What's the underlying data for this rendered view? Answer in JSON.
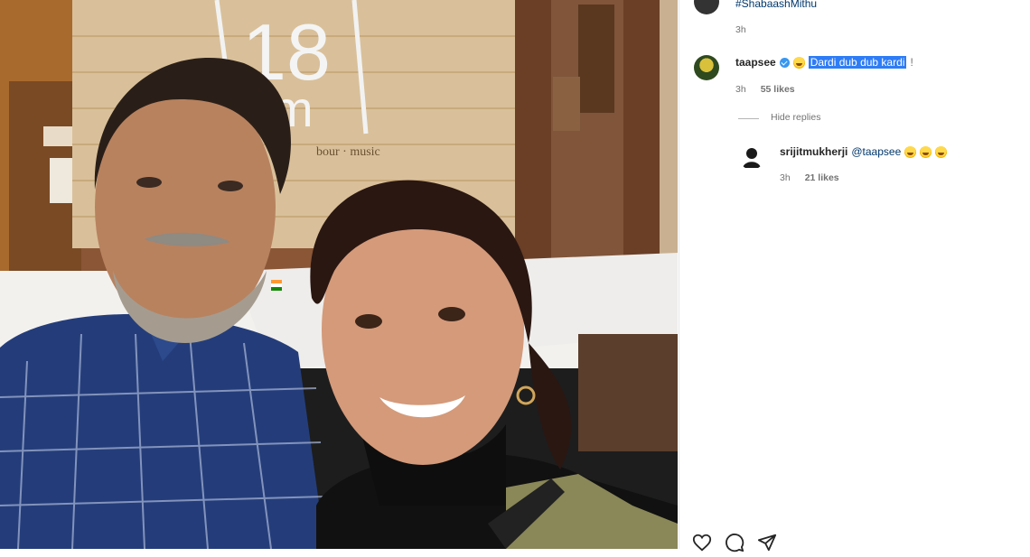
{
  "post_photo": {
    "wall_logo_numbers": "18",
    "wall_logo_letter": "m",
    "wall_tagline": "bour · music"
  },
  "comments": {
    "previous": {
      "hashtag": "#ShabaashMithu",
      "time": "3h"
    },
    "main": {
      "username": "taapsee",
      "verified": true,
      "emoji": "grinning-face-with-sweat-emoji",
      "text": "Dardi dub dub kardi",
      "trailing_text": "!",
      "time": "3h",
      "likes": "55 likes",
      "hide_replies": "Hide replies"
    },
    "reply": {
      "username": "srijitmukherji",
      "mention": "@taapsee",
      "emojis": [
        "rolling-laughing-emoji",
        "rolling-laughing-emoji",
        "rolling-laughing-emoji"
      ],
      "time": "3h",
      "likes": "21 likes"
    }
  },
  "action_bar": {
    "icons": [
      "heart-icon",
      "comment-icon",
      "share-icon"
    ]
  }
}
